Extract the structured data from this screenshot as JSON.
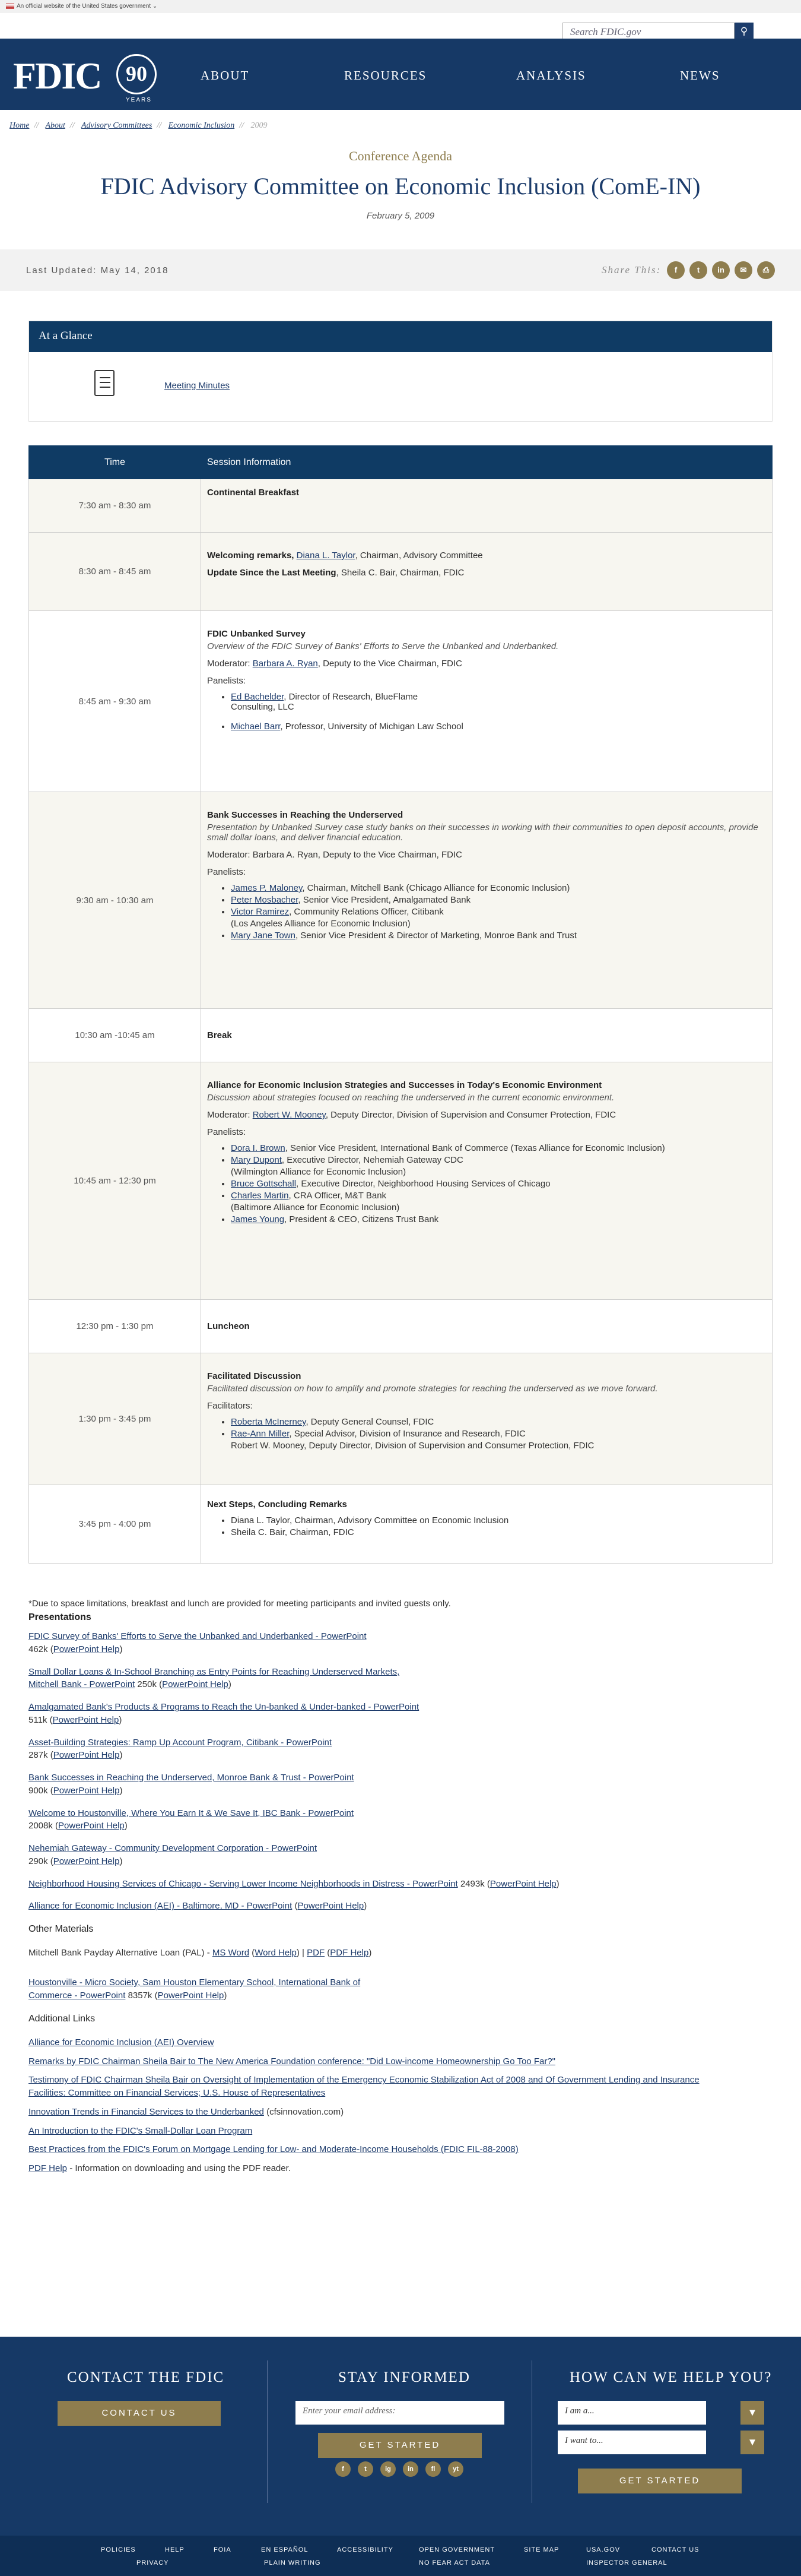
{
  "gov_banner": "An official website of the United States government",
  "search": {
    "placeholder": "Search FDIC.gov"
  },
  "logo": {
    "text": "FDIC",
    "num": "90",
    "years": "YEARS"
  },
  "nav": [
    "ABOUT",
    "RESOURCES",
    "ANALYSIS",
    "NEWS"
  ],
  "breadcrumb": [
    "Home",
    "About",
    "Advisory Committees",
    "Economic Inclusion",
    "2009"
  ],
  "header": {
    "kicker": "Conference Agenda",
    "title": "FDIC Advisory Committee on Economic Inclusion (ComE-IN)",
    "date": "February 5, 2009"
  },
  "updated": "Last Updated: May 14, 2018",
  "share_label": "Share This:",
  "share_icons": [
    "facebook-icon",
    "twitter-icon",
    "linkedin-icon",
    "email-icon",
    "print-icon"
  ],
  "glance": {
    "title": "At a Glance",
    "link": "Meeting Minutes"
  },
  "schedule": {
    "col_time": "Time",
    "col_session": "Session Information",
    "rows": [
      {
        "time": "7:30 am - 8:30 am",
        "title": "Continental Breakfast"
      },
      {
        "time": "8:30 am - 8:45 am",
        "l1_title": "Welcoming remarks, ",
        "l1_link": "Diana L. Taylor",
        "l1_rest": ", Chairman, Advisory Committee",
        "l2_title": "Update Since the Last Meeting",
        "l2_rest": ", Sheila C. Bair, Chairman, FDIC"
      },
      {
        "time": "8:45 am - 9:30 am",
        "title": "FDIC Unbanked Survey",
        "desc": "Overview of the FDIC Survey of Banks' Efforts to Serve the Unbanked and Underbanked.",
        "mod_label": "Moderator: ",
        "mod_link": "Barbara A. Ryan",
        "mod_rest": ", Deputy to the Vice Chairman, FDIC",
        "panel_label": "Panelists:",
        "p1_link": "Ed Bachelder",
        "p1_rest": ", Director of Research, BlueFlame",
        "p1_rest2": "Consulting,  LLC",
        "p2_link": "Michael Barr",
        "p2_rest": ", Professor, University of Michigan Law School"
      },
      {
        "time": "9:30 am - 10:30 am",
        "title": "Bank Successes in Reaching the Underserved",
        "desc": "Presentation by Unbanked Survey case study banks on their successes in working with their communities to open deposit accounts, provide small dollar loans, and deliver financial education.",
        "mod": "Moderator: Barbara A. Ryan, Deputy to the Vice Chairman, FDIC",
        "panel_label": "Panelists:",
        "panelists": [
          {
            "link": "James P. Maloney",
            "rest": ", Chairman, Mitchell Bank (Chicago Alliance for Economic Inclusion)"
          },
          {
            "link": "Peter Mosbacher",
            "rest": ", Senior Vice President, Amalgamated Bank"
          },
          {
            "link": "Victor Ramirez",
            "rest": ", Community Relations Officer, Citibank"
          },
          {
            "link": "",
            "rest": "(Los Angeles Alliance for Economic Inclusion)"
          },
          {
            "link": "Mary Jane Town",
            "rest": ", Senior Vice President & Director of Marketing, Monroe Bank and Trust"
          }
        ]
      },
      {
        "time": "10:30 am -10:45 am",
        "title": "Break"
      },
      {
        "time": "10:45 am - 12:30 pm",
        "title": "Alliance for Economic Inclusion Strategies and Successes in Today's Economic Environment",
        "desc": "Discussion about strategies focused on reaching the underserved in the current economic environment.",
        "mod_label": "Moderator: ",
        "mod_link": "Robert W. Mooney",
        "mod_rest": ", Deputy Director, Division of Supervision and Consumer Protection, FDIC",
        "panel_label": "Panelists:",
        "panelists": [
          {
            "link": "Dora I. Brown",
            "rest": ", Senior Vice President, International Bank of Commerce (Texas Alliance for Economic Inclusion)"
          },
          {
            "link": "Mary Dupont",
            "rest": ", Executive Director, Nehemiah Gateway CDC"
          },
          {
            "link": "",
            "rest": "(Wilmington Alliance for Economic Inclusion)"
          },
          {
            "link": "Bruce Gottschall",
            "rest": ", Executive Director, Neighborhood Housing Services of Chicago"
          },
          {
            "link": "Charles Martin",
            "rest": ", CRA Officer, M&T Bank"
          },
          {
            "link": "",
            "rest": "(Baltimore Alliance for Economic Inclusion)"
          },
          {
            "link": "James Young",
            "rest": ", President & CEO, Citizens Trust Bank"
          }
        ]
      },
      {
        "time": "12:30 pm - 1:30 pm",
        "title": "Luncheon"
      },
      {
        "time": "1:30 pm - 3:45 pm",
        "title": "Facilitated Discussion",
        "desc": "Facilitated discussion on how to amplify and promote strategies for reaching the underserved as we move forward.",
        "fac_label": "Facilitators:",
        "facilitators": [
          {
            "link": "Roberta McInerney",
            "rest": ", Deputy General Counsel, FDIC"
          },
          {
            "link": "Rae-Ann Miller",
            "rest": ", Special Advisor, Division of Insurance and Research, FDIC"
          },
          {
            "link": "",
            "rest": "Robert W. Mooney, Deputy Director, Division of Supervision and Consumer Protection, FDIC"
          }
        ]
      },
      {
        "time": "3:45 pm - 4:00 pm",
        "title": "Next Steps, Concluding Remarks",
        "items": [
          "Diana L. Taylor, Chairman, Advisory Committee on Economic Inclusion",
          "Sheila C. Bair, Chairman, FDIC"
        ]
      }
    ]
  },
  "footnote": "*Due to space limitations, breakfast and lunch are provided for meeting participants and invited guests only.",
  "presentations": {
    "heading": "Presentations",
    "items": [
      {
        "link": "FDIC Survey of Banks' Efforts to Serve the Unbanked and Underbanked - PowerPoint",
        "size": "462k",
        "help": "PowerPoint Help"
      },
      {
        "link": "Small Dollar Loans & In-School Branching as Entry Points for Reaching Underserved Markets,",
        "link2": "Mitchell Bank - PowerPoint",
        "size": "250k",
        "help": "PowerPoint Help"
      },
      {
        "link": "Amalgamated Bank's Products & Programs to Reach the Un-banked & Under-banked - PowerPoint",
        "size": "511k",
        "help": "PowerPoint Help"
      },
      {
        "link": "Asset-Building Strategies: Ramp Up Account Program, Citibank - PowerPoint",
        "size": "287k",
        "help": "PowerPoint Help"
      },
      {
        "link": "Bank Successes in Reaching the Underserved, Monroe Bank & Trust - PowerPoint",
        "size": "900k",
        "help": "PowerPoint Help"
      },
      {
        "link": "Welcome to Houstonville, Where You Earn It & We Save It, IBC Bank - PowerPoint",
        "size": "2008k",
        "help": "PowerPoint Help"
      },
      {
        "link": "Nehemiah Gateway - Community Development Corporation - PowerPoint",
        "size": "290k",
        "help": "PowerPoint Help"
      }
    ],
    "nhs": {
      "link": "Neighborhood Housing Services of Chicago - Serving Lower Income Neighborhoods in Distress - PowerPoint",
      "size": "2493k",
      "help": "PowerPoint Help"
    },
    "aei": {
      "link": "Alliance for Economic Inclusion (AEI) - Baltimore, MD - PowerPoint",
      "help": "PowerPoint Help"
    }
  },
  "other": {
    "heading": "Other Materials",
    "mitchell": {
      "text": "Mitchell Bank Payday Alternative Loan (PAL) - ",
      "word": "MS Word",
      "word_help": "Word Help",
      "pdf": "PDF",
      "pdf_help": "PDF Help"
    },
    "houston": {
      "link": "Houstonville - Micro Society, Sam Houston Elementary School, International Bank of",
      "link2": "Commerce - PowerPoint",
      "size": "8357k",
      "help": "PowerPoint Help"
    }
  },
  "additional": {
    "heading": "Additional Links",
    "links": [
      {
        "link": "Alliance for Economic Inclusion (AEI) Overview"
      },
      {
        "link": "Remarks by FDIC Chairman Sheila Bair to The New America Foundation conference: \"Did Low-income Homeownership Go Too Far?\""
      },
      {
        "link": "Testimony of FDIC Chairman Sheila Bair on Oversight of Implementation of the Emergency Economic Stabilization Act of 2008 and Of Government Lending and Insurance",
        "link2": "Facilities: Committee on Financial Services; U.S. House of Representatives"
      },
      {
        "link": "Innovation Trends in Financial Services to the Underbanked",
        "rest": " (cfsinnovation.com)"
      },
      {
        "link": "An Introduction to the FDIC's Small-Dollar Loan Program"
      },
      {
        "link": "Best Practices from the FDIC's Forum on Mortgage Lending for Low- and Moderate-Income Households (FDIC FIL-88-2008)"
      },
      {
        "link": "PDF Help",
        "rest": " - Information on downloading and using the PDF reader."
      }
    ]
  },
  "footer": {
    "contact_heading": "CONTACT THE FDIC",
    "contact_btn": "CONTACT US",
    "stay_heading": "STAY INFORMED",
    "email_placeholder": "Enter your email address:",
    "started": "GET STARTED",
    "help_heading": "HOW CAN WE HELP YOU?",
    "iam": "I am a...",
    "iwant": "I want to...",
    "social": [
      "f",
      "t",
      "ig",
      "in",
      "fl",
      "yt"
    ]
  },
  "sublinks": [
    "POLICIES",
    "HELP",
    "FOIA",
    "EN ESPAÑOL",
    "ACCESSIBILITY",
    "OPEN GOVERNMENT",
    "SITE MAP",
    "USA.GOV",
    "CONTACT US",
    "PRIVACY",
    "PLAIN WRITING",
    "NO FEAR ACT DATA",
    "INSPECTOR GENERAL"
  ]
}
